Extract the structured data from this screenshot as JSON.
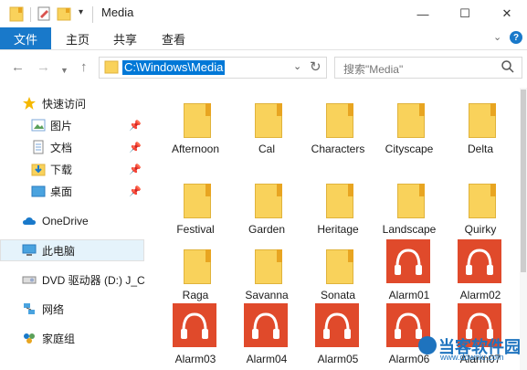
{
  "window": {
    "title": "Media"
  },
  "ribbon": {
    "tabs": [
      "文件",
      "主页",
      "共享",
      "查看"
    ]
  },
  "address": {
    "path": "C:\\Windows\\Media",
    "search_placeholder": "搜索\"Media\""
  },
  "nav": {
    "quick_access": "快速访问",
    "pictures": "图片",
    "documents": "文档",
    "downloads": "下载",
    "desktop": "桌面",
    "onedrive": "OneDrive",
    "this_pc": "此电脑",
    "dvd": "DVD 驱动器 (D:) J_C",
    "network": "网络",
    "homegroup": "家庭组"
  },
  "items": [
    {
      "name": "Afternoon",
      "type": "folder"
    },
    {
      "name": "Cal",
      "type": "folder"
    },
    {
      "name": "Characters",
      "type": "folder"
    },
    {
      "name": "Cityscape",
      "type": "folder"
    },
    {
      "name": "Delta",
      "type": "folder"
    },
    {
      "name": "Festival",
      "type": "folder"
    },
    {
      "name": "Garden",
      "type": "folder"
    },
    {
      "name": "Heritage",
      "type": "folder"
    },
    {
      "name": "Landscape",
      "type": "folder"
    },
    {
      "name": "Quirky",
      "type": "folder"
    },
    {
      "name": "Raga",
      "type": "folder"
    },
    {
      "name": "Savanna",
      "type": "folder"
    },
    {
      "name": "Sonata",
      "type": "folder"
    },
    {
      "name": "Alarm01",
      "type": "audio"
    },
    {
      "name": "Alarm02",
      "type": "audio"
    },
    {
      "name": "Alarm03",
      "type": "audio"
    },
    {
      "name": "Alarm04",
      "type": "audio"
    },
    {
      "name": "Alarm05",
      "type": "audio"
    },
    {
      "name": "Alarm06",
      "type": "audio"
    },
    {
      "name": "Alarm07",
      "type": "audio"
    }
  ],
  "watermark": {
    "text": "当客软件园",
    "url": "www.downkr.com"
  },
  "colors": {
    "accent": "#1979ca",
    "folder": "#f9d25b",
    "audio_tile": "#e04a2b"
  }
}
